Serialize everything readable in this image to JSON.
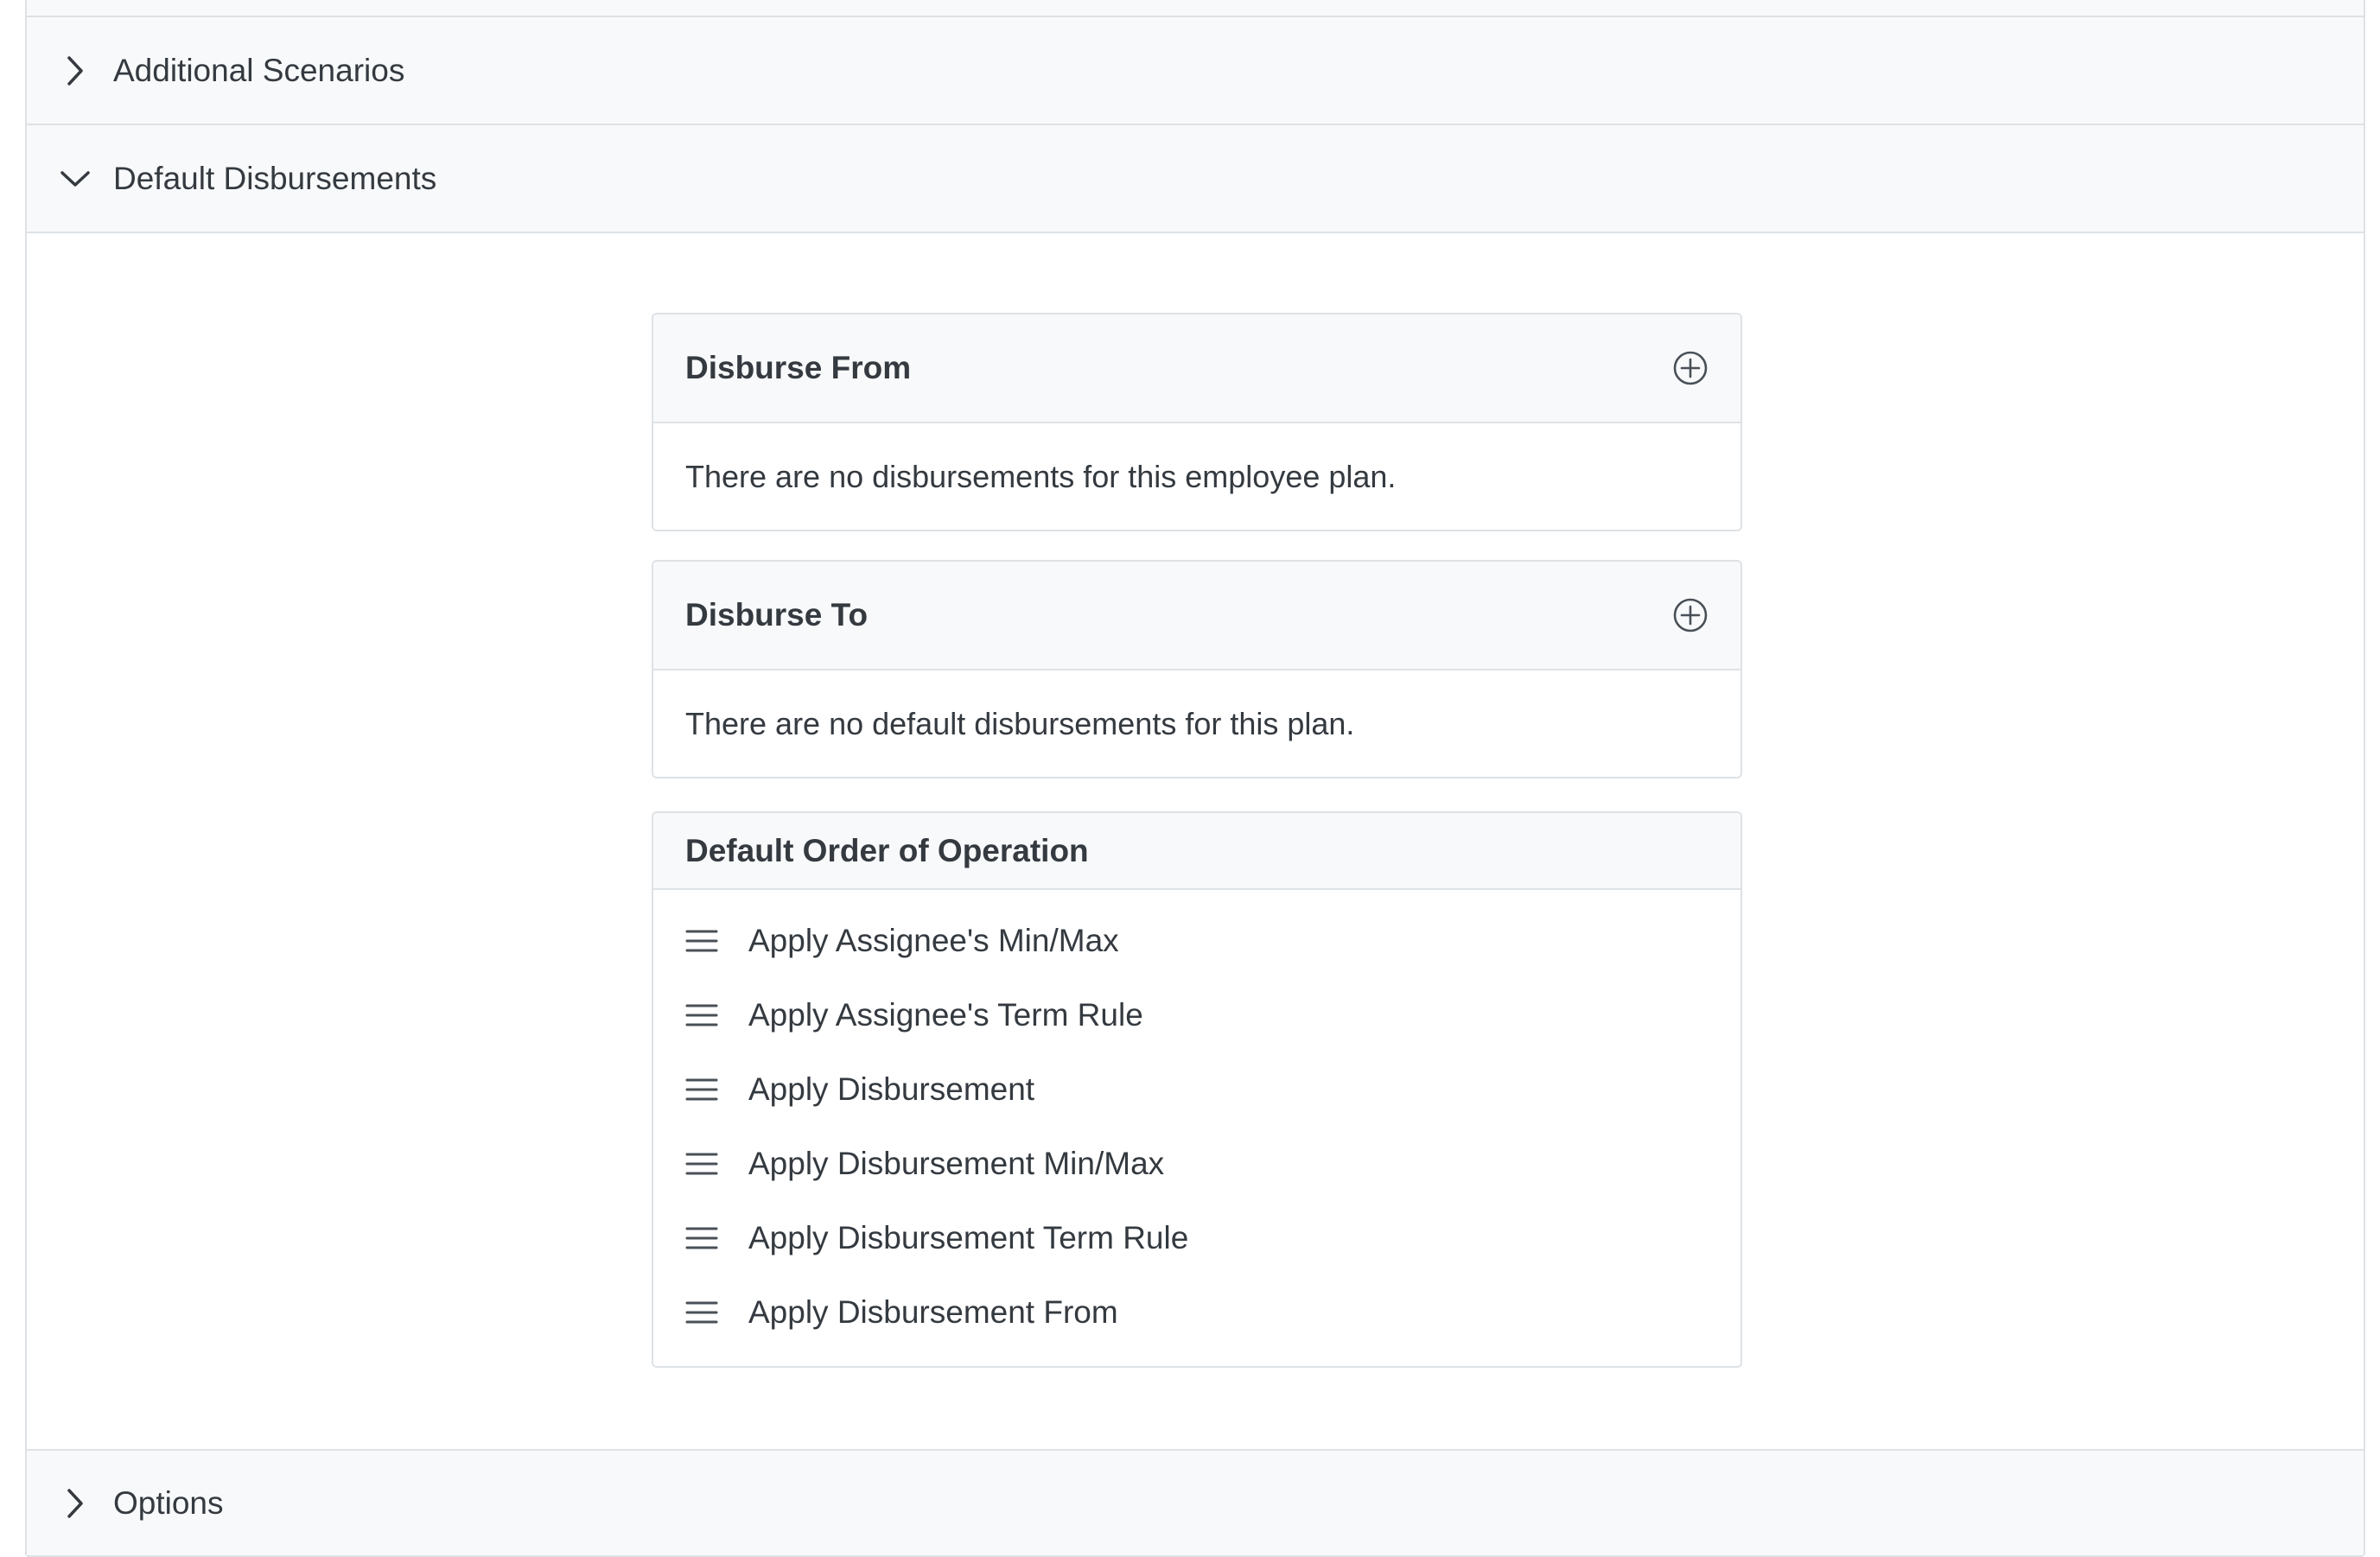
{
  "sections": {
    "additional_scenarios": {
      "label": "Additional Scenarios",
      "expanded": false,
      "icon": "chevron-right-icon"
    },
    "default_disbursements": {
      "label": "Default Disbursements",
      "expanded": true,
      "icon": "chevron-down-icon"
    },
    "options": {
      "label": "Options",
      "expanded": false,
      "icon": "chevron-right-icon"
    }
  },
  "disburse_from": {
    "title": "Disburse From",
    "add_icon": "plus-circle-icon",
    "empty_message": "There are no disbursements for this employee plan."
  },
  "disburse_to": {
    "title": "Disburse To",
    "add_icon": "plus-circle-icon",
    "empty_message": "There are no default disbursements for this plan."
  },
  "order_of_operation": {
    "title": "Default Order of Operation",
    "handle_icon": "drag-handle-icon",
    "items": [
      {
        "label": "Apply Assignee's Min/Max"
      },
      {
        "label": "Apply Assignee's Term Rule"
      },
      {
        "label": "Apply Disbursement"
      },
      {
        "label": "Apply Disbursement Min/Max"
      },
      {
        "label": "Apply Disbursement Term Rule"
      },
      {
        "label": "Apply Disbursement From"
      }
    ]
  },
  "colors": {
    "header_bg": "#f8f9fa",
    "border": "#dee2e6",
    "text": "#343a40",
    "icon": "#495057"
  }
}
